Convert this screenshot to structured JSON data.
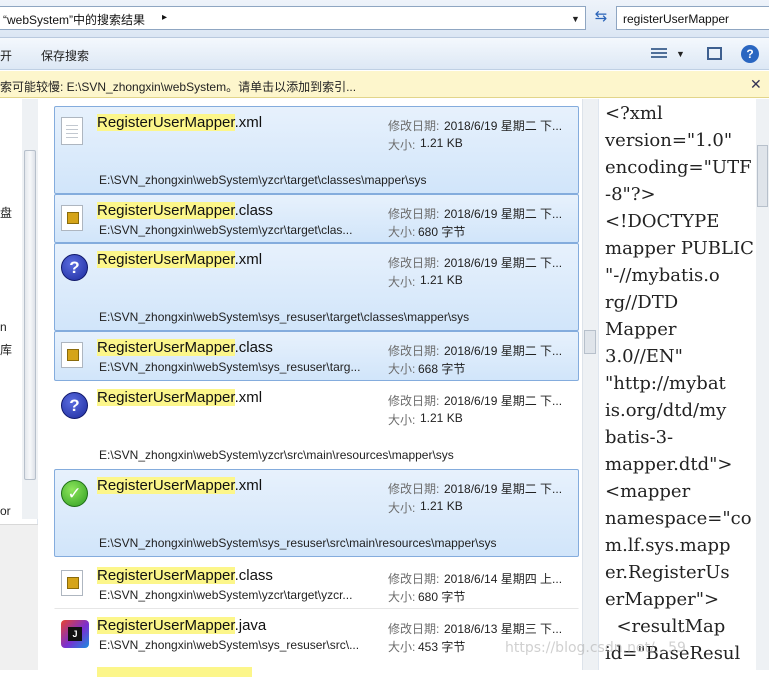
{
  "address": {
    "text": "“webSystem”中的搜索结果",
    "separator": "▸",
    "dropdown": "▼",
    "refresh": "⇆"
  },
  "search": {
    "value": "registerUserMapper"
  },
  "toolbar": {
    "open_fragment": "开",
    "save_search": "保存搜索",
    "dropdown": "▼",
    "help": "?"
  },
  "infobar": {
    "text": "索可能较慢: E:\\SVN_zhongxin\\webSystem。请单击以添加到索引...",
    "close": "✕"
  },
  "nav": {
    "fragments": [
      "盘",
      "n",
      "库",
      "or"
    ]
  },
  "labels": {
    "date": "修改日期:",
    "size": "大小:"
  },
  "results": [
    {
      "highlight": "RegisterUserMapper",
      "ext": ".xml",
      "icon": "xml-doc-icon",
      "date": "2018/6/19 星期二 下...",
      "size": "1.21 KB",
      "path": "E:\\SVN_zhongxin\\webSystem\\yzcr\\target\\classes\\mapper\\sys",
      "selected": true
    },
    {
      "highlight": "RegisterUserMapper",
      "ext": ".class",
      "icon": "class-file-icon",
      "date": "2018/6/19 星期二 下...",
      "size": "680 字节",
      "path": "E:\\SVN_zhongxin\\webSystem\\yzcr\\target\\clas...",
      "selected": true
    },
    {
      "highlight": "RegisterUserMapper",
      "ext": ".xml",
      "icon": "svn-unversioned-icon",
      "date": "2018/6/19 星期二 下...",
      "size": "1.21 KB",
      "path": "E:\\SVN_zhongxin\\webSystem\\sys_resuser\\target\\classes\\mapper\\sys",
      "selected": true
    },
    {
      "highlight": "RegisterUserMapper",
      "ext": ".class",
      "icon": "class-unversioned-icon",
      "date": "2018/6/19 星期二 下...",
      "size": "668 字节",
      "path": "E:\\SVN_zhongxin\\webSystem\\sys_resuser\\targ...",
      "selected": true
    },
    {
      "highlight": "RegisterUserMapper",
      "ext": ".xml",
      "icon": "svn-unversioned-icon",
      "date": "2018/6/19 星期二 下...",
      "size": "1.21 KB",
      "path": "E:\\SVN_zhongxin\\webSystem\\yzcr\\src\\main\\resources\\mapper\\sys",
      "selected": false
    },
    {
      "highlight": "RegisterUserMapper",
      "ext": ".xml",
      "icon": "svn-normal-icon",
      "date": "2018/6/19 星期二 下...",
      "size": "1.21 KB",
      "path": "E:\\SVN_zhongxin\\webSystem\\sys_resuser\\src\\main\\resources\\mapper\\sys",
      "selected": true
    },
    {
      "highlight": "RegisterUserMapper",
      "ext": ".class",
      "icon": "class-file-icon",
      "date": "2018/6/14 星期四 上...",
      "size": "680 字节",
      "path": "E:\\SVN_zhongxin\\webSystem\\yzcr\\target\\yzcr...",
      "selected": false
    },
    {
      "highlight": "RegisterUserMapper",
      "ext": ".java",
      "icon": "java-file-icon",
      "date": "2018/6/13 星期三 下...",
      "size": "453 字节",
      "path": "E:\\SVN_zhongxin\\webSystem\\sys_resuser\\src\\...",
      "selected": false
    }
  ],
  "preview": {
    "lines": [
      "<?xml",
      "version=\"1.0\"",
      "encoding=\"UTF",
      "-8\"?>",
      "<!DOCTYPE",
      "mapper PUBLIC",
      "\"-//mybatis.o",
      "rg//DTD",
      "Mapper",
      "3.0//EN\"",
      "\"http://mybat",
      "is.org/dtd/my",
      "batis-3-",
      "mapper.dtd\">",
      "<mapper",
      "namespace=\"co",
      "m.lf.sys.mapp",
      "er.RegisterUs",
      "erMapper\">",
      "  <resultMap",
      "id=\"BaseResul"
    ]
  },
  "watermark": "https://blog.csdn.net/...59"
}
